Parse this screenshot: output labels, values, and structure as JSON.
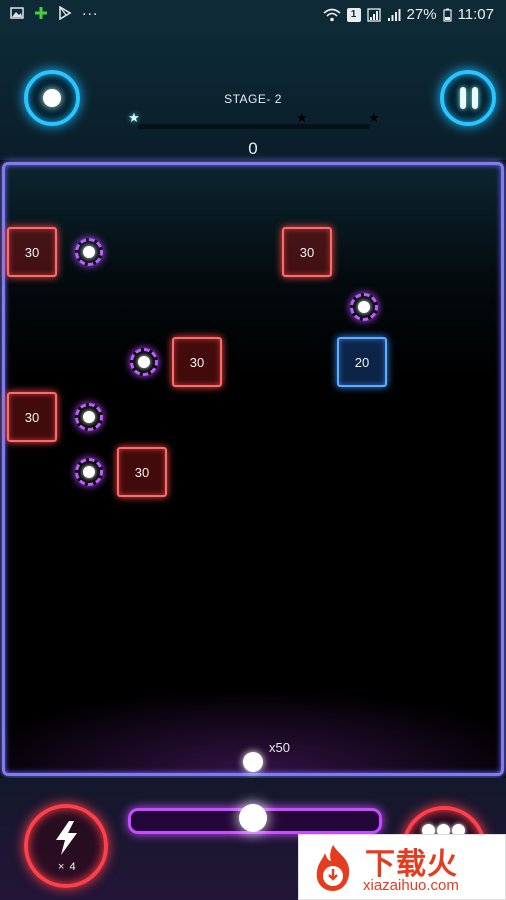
{
  "status_bar": {
    "battery": "27%",
    "time": "11:07",
    "sim_badge": "1",
    "overflow": "..."
  },
  "header": {
    "stage_label": "STAGE- 2",
    "score": "0",
    "stage_progress": 0,
    "stars_earned": 1,
    "stars_total": 3
  },
  "bricks": [
    {
      "value": "30",
      "color": "red"
    },
    {
      "value": "30",
      "color": "red"
    },
    {
      "value": "30",
      "color": "red"
    },
    {
      "value": "20",
      "color": "blue"
    },
    {
      "value": "30",
      "color": "red"
    },
    {
      "value": "30",
      "color": "red"
    }
  ],
  "ball_count": "x50",
  "powerup": {
    "count": "× 4"
  },
  "watermark": {
    "title": "下载火",
    "subtitle": "xiazaihuo.com"
  },
  "colors": {
    "cyan": "#27c6ff",
    "purple": "#c84cff",
    "red": "#ff3f4a",
    "brick_red": "#ff6b6b",
    "brick_blue": "#5ab0ff"
  }
}
